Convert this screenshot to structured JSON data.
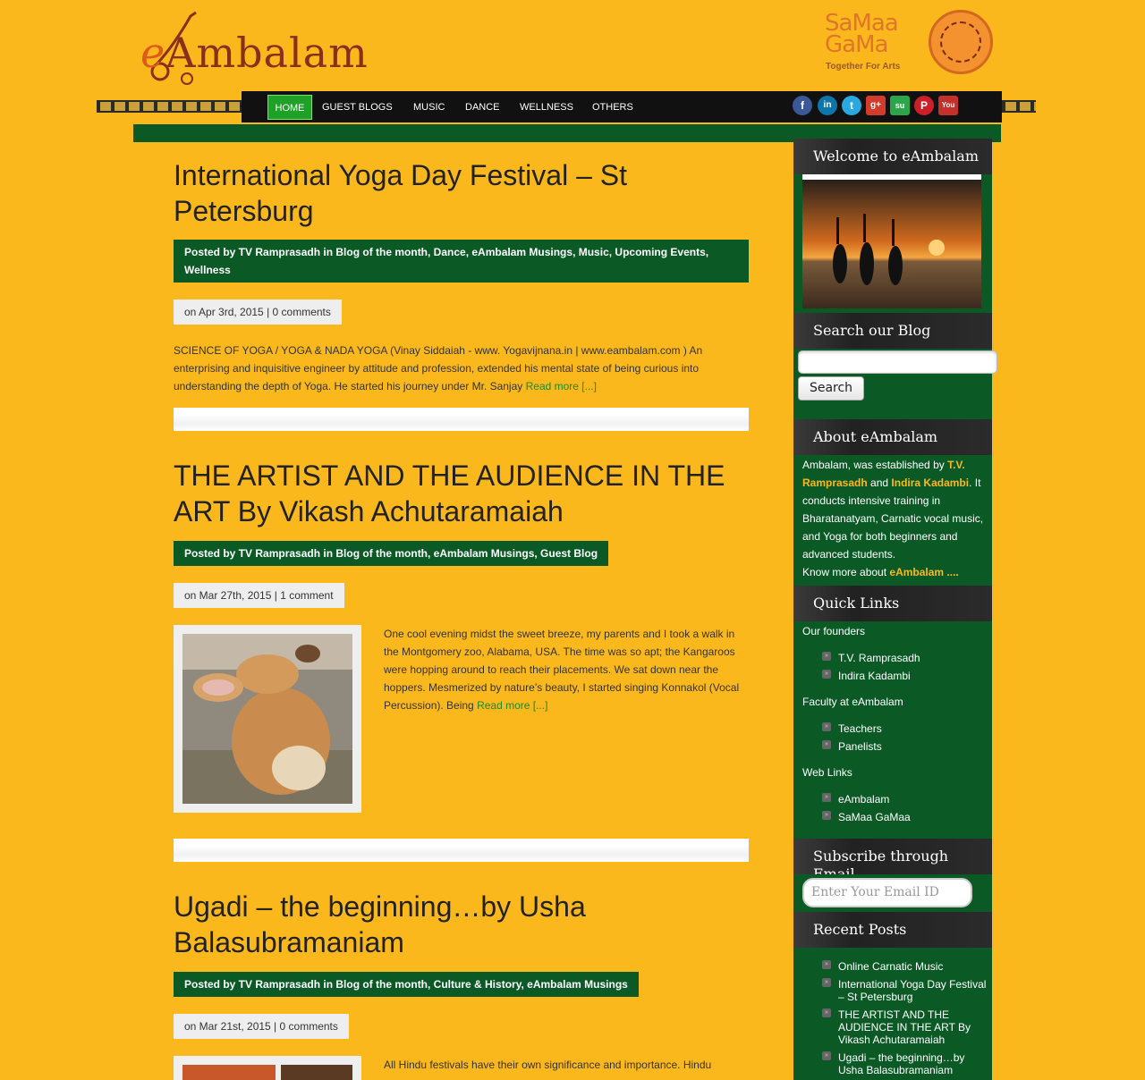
{
  "header": {
    "logo_e": "e",
    "logo_rest": "Ambalam",
    "brand2_line1": "SaMaa",
    "brand2_line2": "GaMa",
    "brand2_tagline": "Together For Arts"
  },
  "nav": {
    "items": [
      "HOME",
      "GUEST BLOGS",
      "MUSIC",
      "DANCE",
      "WELLNESS",
      "OTHERS"
    ],
    "social": [
      {
        "icon": "facebook-icon",
        "glyph": "f",
        "color": "#3b5998"
      },
      {
        "icon": "linkedin-icon",
        "glyph": "in",
        "color": "#0e76a8"
      },
      {
        "icon": "twitter-icon",
        "glyph": "t",
        "color": "#2aa9e0"
      },
      {
        "icon": "google-plus-icon",
        "glyph": "g+",
        "color": "#d23c2a"
      },
      {
        "icon": "stumbleupon-icon",
        "glyph": "su",
        "color": "#2ca64b"
      },
      {
        "icon": "pinterest-icon",
        "glyph": "P",
        "color": "#cb2027"
      },
      {
        "icon": "youtube-icon",
        "glyph": "You",
        "color": "#c4302b"
      }
    ]
  },
  "posts": [
    {
      "title": "International Yoga Day Festival – St Petersburg",
      "meta": "Posted by TV Ramprasadh in Blog of the month, Dance, eAmbalam Musings, Music, Upcoming Events, Wellness",
      "date_prefix": "on Apr 3rd, 2015 | ",
      "comments": "0 comments",
      "excerpt": " SCIENCE OF YOGA / YOGA & NADA YOGA (Vinay Siddaiah  -     www. Yogavijnana.in |  www.eambalam.com ) An enterprising and inquisitive engineer by attitude and profession, extended his mental state of being curious into understanding the depth of Yoga. He started his journey under Mr. Sanjay ",
      "read_more": "Read more [...]"
    },
    {
      "title": "THE ARTIST AND THE AUDIENCE IN THE ART By Vikash Achutaramaiah",
      "meta": "Posted by TV Ramprasadh in Blog of the month, eAmbalam Musings, Guest Blog",
      "date_prefix": "on Mar 27th, 2015 | ",
      "comments": "1 comment",
      "excerpt": "One cool evening midst the sweet breeze, my parents and I took a walk in the Montgomery zoo, Alabama, USA. The time was so apt; the Kangaroos were hopping around to reach their placements. We sat down near the hoppers. Mesmerized by nature’s beauty, I started singing Konnakol (Vocal Percussion). Being ",
      "read_more": "Read more [...]"
    },
    {
      "title": "Ugadi – the beginning…by Usha Balasubramaniam",
      "meta": "Posted by TV Ramprasadh in Blog of the month, Culture & History, eAmbalam Musings",
      "date_prefix": "on Mar 21st, 2015 | ",
      "comments": "0 comments",
      "excerpt": "All Hindu festivals have their own significance and importance. Hindu"
    }
  ],
  "sidebar": {
    "welcome_title": "Welcome to eAmbalam",
    "search_title": "Search our Blog",
    "search_button": "Search",
    "about_title": "About eAmbalam",
    "about_text_1": "Ambalam, was established by ",
    "about_link_1": "T.V. Ramprasadh",
    "about_text_2": " and ",
    "about_link_2": "Indira Kadambi",
    "about_text_3": ". It conducts intensive training in Bharatanatyam, Carnatic vocal music, and Yoga for both beginners and advanced students.",
    "about_more": "Know more about ",
    "about_more_link": "eAmbalam ....",
    "quick_links_title": "Quick Links",
    "quick_links": [
      {
        "heading": "Our founders",
        "items": [
          "T.V. Ramprasadh",
          "Indira Kadambi"
        ]
      },
      {
        "heading": "Faculty at eAmbalam",
        "items": [
          "Teachers",
          "Panelists"
        ]
      },
      {
        "heading": "Web Links",
        "items": [
          "eAmbalam",
          "SaMaa GaMaa"
        ]
      }
    ],
    "subscribe_title": "Subscribe through Email",
    "email_placeholder": "Enter Your Email ID",
    "recent_title": "Recent Posts",
    "recent_posts": [
      "Online Carnatic Music",
      "International Yoga Day Festival – St Petersburg",
      "THE ARTIST AND THE AUDIENCE IN THE ART By Vikash Achutaramaiah",
      "Ugadi – the beginning…by Usha Balasubramaniam"
    ]
  }
}
